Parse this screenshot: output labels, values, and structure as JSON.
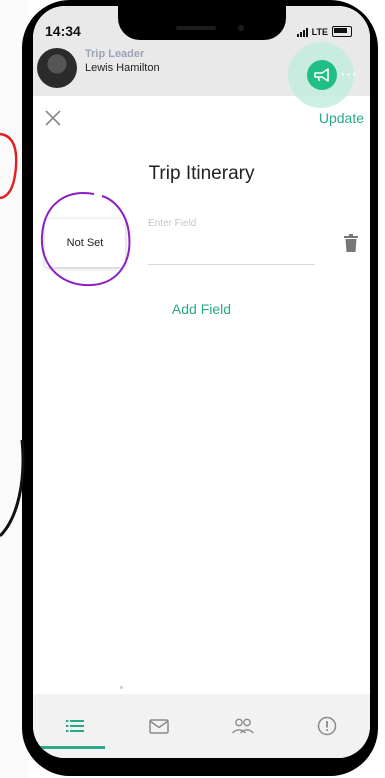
{
  "status_bar": {
    "time": "14:34",
    "network": "LTE"
  },
  "trip_leader": {
    "role": "Trip Leader",
    "name": "Lewis Hamilton"
  },
  "toolbar": {
    "update_label": "Update"
  },
  "page": {
    "title": "Trip Itinerary"
  },
  "itinerary_field": {
    "date_value": "Not Set",
    "field_placeholder": "Enter Field"
  },
  "add_field_label": "Add Field",
  "colors": {
    "accent": "#2aa88a",
    "fab": "#1fbf85",
    "annotation_circle": "#8b1ec4",
    "annotation_red": "#e02020"
  },
  "tabs": [
    {
      "icon": "list-icon",
      "active": true
    },
    {
      "icon": "mail-icon",
      "active": false
    },
    {
      "icon": "people-icon",
      "active": false
    },
    {
      "icon": "alert-icon",
      "active": false
    }
  ]
}
